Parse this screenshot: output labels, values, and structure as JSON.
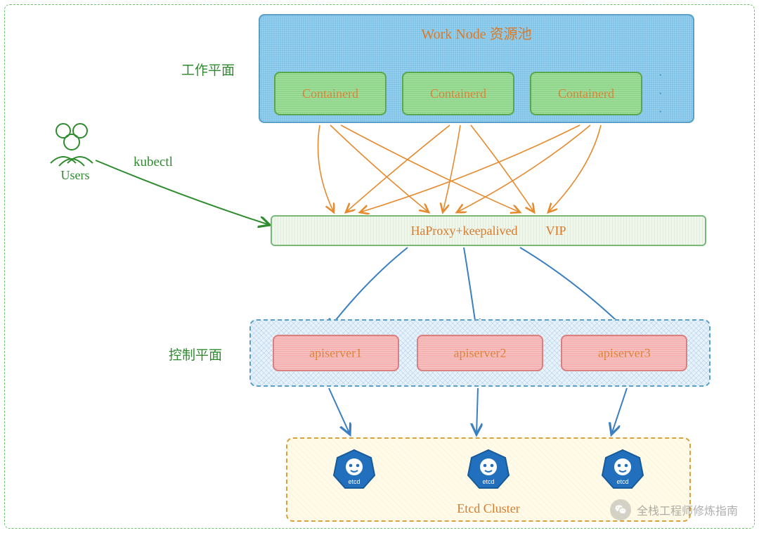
{
  "labels": {
    "work_plane": "工作平面",
    "control_plane": "控制平面",
    "kubectl": "kubectl",
    "users": "Users"
  },
  "worknode": {
    "title": "Work Node 资源池",
    "containers": [
      "Containerd",
      "Containerd",
      "Containerd"
    ],
    "ellipsis": "· · ·"
  },
  "vip": {
    "label_left": "HaProxy+keepalived",
    "label_right": "VIP"
  },
  "apiservers": [
    "apiserver1",
    "apiserver2",
    "apiserver3"
  ],
  "etcd": {
    "title": "Etcd Cluster",
    "node_label": "etcd",
    "count": 3
  },
  "colors": {
    "orange": "#e68a2e",
    "green": "#2e8b2e",
    "blue": "#3a7fc2"
  },
  "watermark": "全栈工程师修炼指南"
}
